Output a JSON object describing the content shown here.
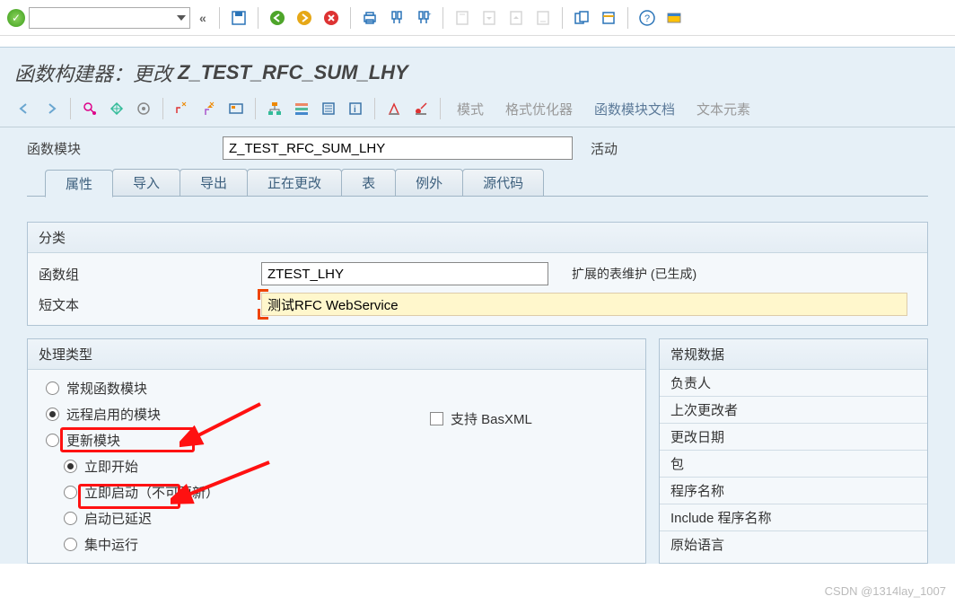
{
  "top": {
    "save_hint": "保存"
  },
  "title": {
    "label": "函数构建器：更改",
    "module_name": "Z_TEST_RFC_SUM_LHY"
  },
  "sub": {
    "mode": "模式",
    "format": "格式优化器",
    "doc": "函数模块文档",
    "text_elem": "文本元素"
  },
  "form": {
    "module_label": "函数模块",
    "module_value": "Z_TEST_RFC_SUM_LHY",
    "status": "活动"
  },
  "tabs": [
    "属性",
    "导入",
    "导出",
    "正在更改",
    "表",
    "例外",
    "源代码"
  ],
  "active_tab": 0,
  "group_class": {
    "header": "分类",
    "fg_label": "函数组",
    "fg_value": "ZTEST_LHY",
    "ext_label": "扩展的表维护 (已生成)",
    "short_label": "短文本",
    "short_value": "测试RFC WebService"
  },
  "proc_type": {
    "header": "处理类型",
    "opts": {
      "normal": "常规函数模块",
      "remote": "远程启用的模块",
      "update": "更新模块",
      "immediate_start": "立即开始",
      "immediate_no_upd": "立即启动（不可更新）",
      "delayed": "启动已延迟",
      "central": "集中运行"
    },
    "basxml": "支持 BasXML"
  },
  "general": {
    "header": "常规数据",
    "owner": "负责人",
    "last_changed": "上次更改者",
    "change_date": "更改日期",
    "package": "包",
    "prog_name": "程序名称",
    "include": "Include 程序名称",
    "orig_lang": "原始语言"
  },
  "watermark": "CSDN @1314lay_1007"
}
